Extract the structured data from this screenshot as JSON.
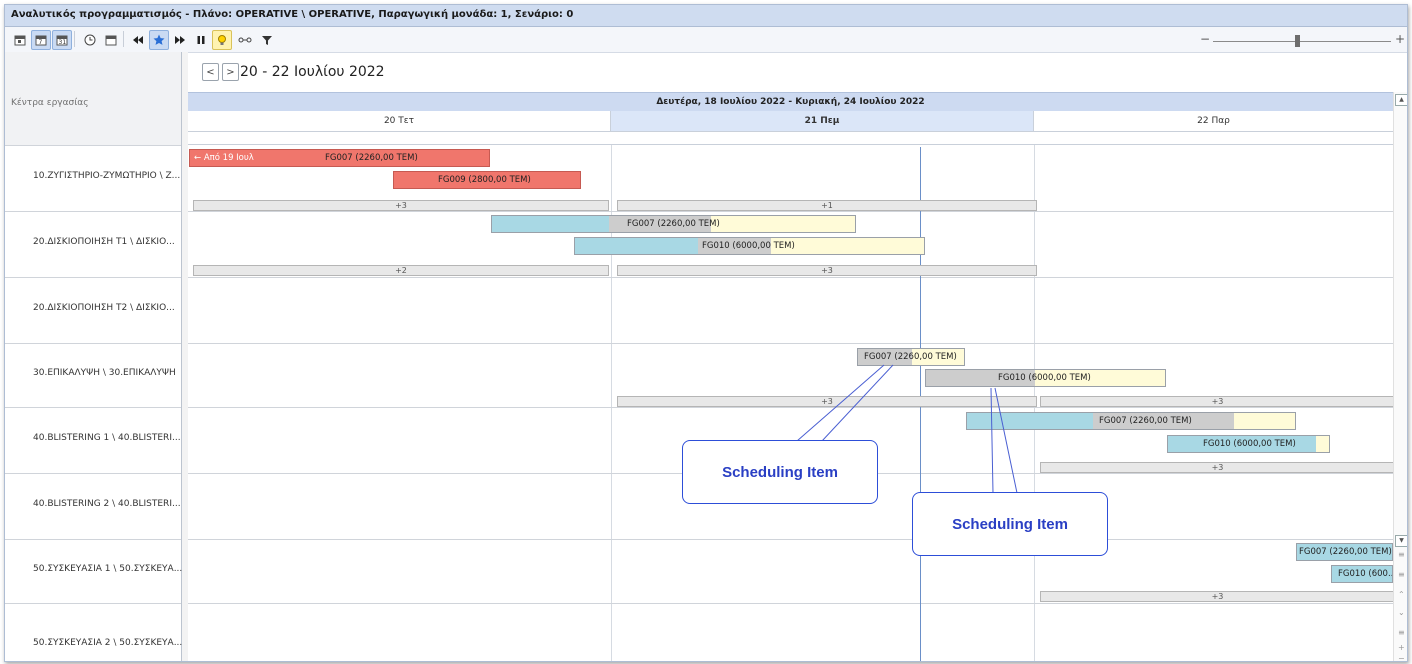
{
  "window_title": "Αναλυτικός προγραμματισμός - Πλάνο: OPERATIVE \\ OPERATIVE, Παραγωγική μονάδα: 1, Σενάριο: 0",
  "toolbar": {
    "buttons": [
      "day-view-icon",
      "week-view-icon",
      "month-view-icon",
      "clock-icon",
      "calendar-icon",
      "rewind-icon",
      "star-icon",
      "fast-forward-icon",
      "pause-icon",
      "lightbulb-icon",
      "link-icon",
      "filter-icon"
    ],
    "zoom_minus": "−",
    "zoom_plus": "+",
    "zoom_level": 0.49
  },
  "left_panel": {
    "header": "Κέντρα εργασίας",
    "rows": [
      "10.ΖΥΓΙΣΤΗΡΙΟ-ΖΥΜΩΤΗΡΙΟ \\ Ζ...",
      "20.ΔΙΣΚΙΟΠΟΙΗΣΗ Τ1 \\ ΔΙΣΚΙΟ...",
      "20.ΔΙΣΚΙΟΠΟΙΗΣΗ Τ2 \\ ΔΙΣΚΙΟ...",
      "30.ΕΠΙΚΑΛΥΨΗ \\ 30.ΕΠΙΚΑΛΥΨΗ",
      "40.BLISTERING 1 \\ 40.BLISTERI...",
      "40.BLISTERING 2 \\ 40.BLISTERI...",
      "50.ΣΥΣΚΕΥΑΣΙΑ 1 \\ 50.ΣΥΣΚΕΥΑ...",
      "50.ΣΥΣΚΕΥΑΣΙΑ 2 \\ 50.ΣΥΣΚΕΥΑ..."
    ]
  },
  "nav": {
    "prev": "<",
    "next": ">",
    "date_range": "20 - 22 Ιουλίου 2022"
  },
  "week_header": "Δευτέρα, 18 Ιουλίου 2022 - Κυριακή, 24 Ιουλίου 2022",
  "days": [
    "20 Τετ",
    "21 Πεμ",
    "22 Παρ"
  ],
  "bars": {
    "b1": "← Από 19 Ιουλ",
    "b1b": "FG007 (2260,00 TEM)",
    "b2": "FG009 (2800,00 TEM)",
    "b3": "FG007 (2260,00 TEM)",
    "b4": "FG010 (6000,00 TEM)",
    "b5": "FG007 (2260,00 TEM)",
    "b6": "FG010 (6000,00 TEM)",
    "b7": "FG007 (2260,00 TEM)",
    "b8": "FG010 (6000,00 TEM)",
    "b9": "FG007 (2260,00 TEM)",
    "b10": "FG010 (600..."
  },
  "more": {
    "r1a": "+3",
    "r1b": "+1",
    "r2a": "+2",
    "r2b": "+3",
    "r4b": "+3",
    "r4c": "+3",
    "r5c": "+3",
    "r7c": "+3"
  },
  "callouts": {
    "c1": "Scheduling Item",
    "c2": "Scheduling Item"
  },
  "colors": {
    "bar_red": "#f0766c",
    "bar_blue": "#a8d8e4",
    "bar_gray": "#cdcdcd",
    "bar_yellow": "#fffbd8",
    "callout_blue": "#2d4ed8",
    "today": "#dbe6f8"
  }
}
